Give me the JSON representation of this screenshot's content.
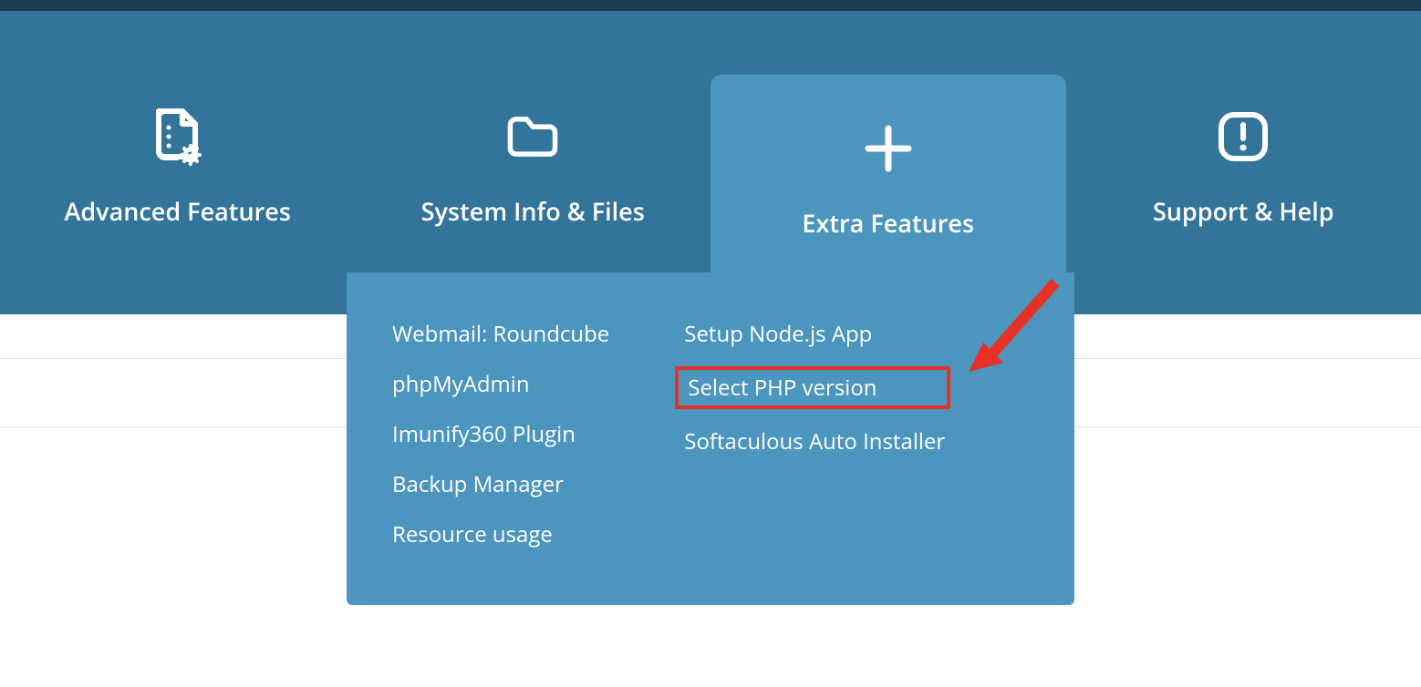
{
  "nav": {
    "tabs": [
      {
        "label": "Advanced Features",
        "icon": "file-gear-icon",
        "active": false
      },
      {
        "label": "System Info & Files",
        "icon": "folder-icon",
        "active": false
      },
      {
        "label": "Extra Features",
        "icon": "plus-icon",
        "active": true
      },
      {
        "label": "Support & Help",
        "icon": "alert-square-icon",
        "active": false
      }
    ]
  },
  "dropdown": {
    "col1": [
      "Webmail: Roundcube",
      "phpMyAdmin",
      "Imunify360 Plugin",
      "Backup Manager",
      "Resource usage"
    ],
    "col2": [
      "Setup Node.js App",
      "Select PHP version",
      "Softaculous Auto Installer"
    ],
    "highlighted": "Select PHP version"
  }
}
